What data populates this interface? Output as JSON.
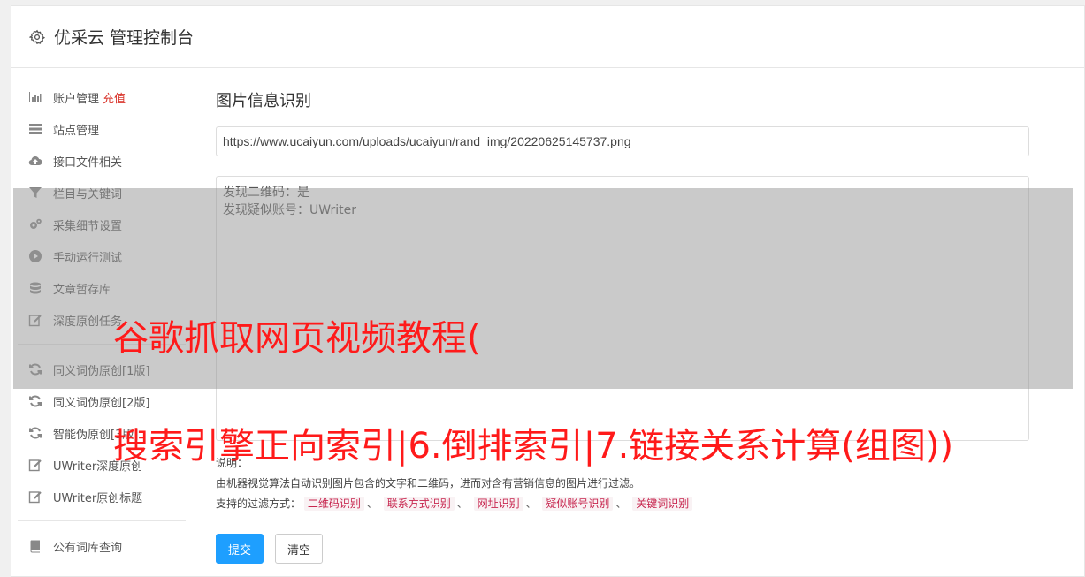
{
  "header": {
    "title": "优采云 管理控制台"
  },
  "sidebar": {
    "items": [
      {
        "label": "账户管理",
        "extra": "充值",
        "icon": "bar-chart-icon"
      },
      {
        "label": "站点管理",
        "icon": "server-icon"
      },
      {
        "label": "接口文件相关",
        "icon": "cloud-upload-icon"
      },
      {
        "label": "栏目与关键词",
        "icon": "filter-icon"
      },
      {
        "label": "采集细节设置",
        "icon": "cogs-icon"
      },
      {
        "label": "手动运行测试",
        "icon": "play-circle-icon"
      },
      {
        "label": "文章暂存库",
        "icon": "database-icon"
      },
      {
        "label": "深度原创任务",
        "icon": "edit-icon"
      },
      {
        "label": "同义词伪原创[1版]",
        "icon": "refresh-icon"
      },
      {
        "label": "同义词伪原创[2版]",
        "icon": "refresh-icon"
      },
      {
        "label": "智能伪原创[3版]",
        "icon": "refresh-icon"
      },
      {
        "label": "UWriter深度原创",
        "icon": "edit-icon"
      },
      {
        "label": "UWriter原创标题",
        "icon": "edit-icon"
      },
      {
        "label": "公有词库查询",
        "icon": "book-icon"
      }
    ]
  },
  "main": {
    "section_title": "图片信息识别",
    "url_value": "https://www.ucaiyun.com/uploads/ucaiyun/rand_img/20220625145737.png",
    "result_lines": [
      "发现二维码：是",
      "发现疑似账号：UWriter"
    ],
    "note_label": "说明：",
    "note_desc": "由机器视觉算法自动识别图片包含的文字和二维码，进而对含有营销信息的图片进行过滤。",
    "filter_label": "支持的过滤方式：",
    "filter_tags": [
      "二维码识别",
      "联系方式识别",
      "网址识别",
      "疑似账号识别",
      "关键词识别"
    ],
    "separator": "、",
    "submit_label": "提交",
    "clear_label": "清空"
  },
  "overlay": {
    "line1": "谷歌抓取网页视频教程(",
    "line2": "搜索引擎正向索引|6.倒排索引|7.链接关系计算(组图))"
  },
  "colors": {
    "accent": "#1e9fff",
    "danger": "#d9342b",
    "tag_text": "#c7254e",
    "tag_bg": "#f9f2f4",
    "overlay_text": "#ff1a1a"
  }
}
